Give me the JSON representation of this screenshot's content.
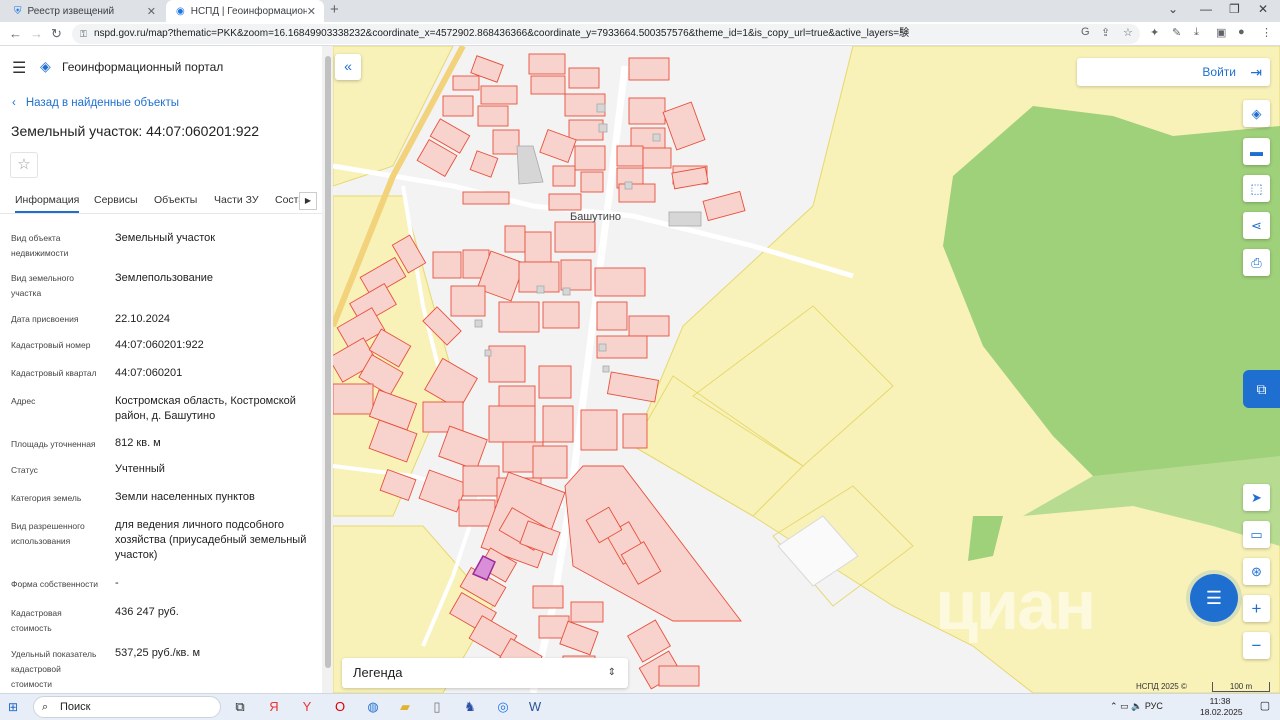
{
  "browser": {
    "tabs": [
      {
        "title": "Реестр извещений",
        "icon": "shield-icon"
      },
      {
        "title": "НСПД | Геоинформационный п",
        "icon": "globe-icon"
      }
    ],
    "url": "nspd.gov.ru/map?thematic=PKK&zoom=16.16849903338232&coordinate_x=4572902.868436366&coordinate_y=7933664.500357576&theme_id=1&is_copy_url=true&active_layers=験"
  },
  "sidebar": {
    "portal_name": "Геоинформационный портал",
    "back_link": "Назад в найденные объекты",
    "title": "Земельный участок: 44:07:060201:922",
    "tabs": [
      "Информация",
      "Сервисы",
      "Объекты",
      "Части ЗУ",
      "Соста"
    ],
    "fields": [
      {
        "label": "Вид объекта недвижимости",
        "value": "Земельный участок"
      },
      {
        "label": "Вид земельного участка",
        "value": "Землепользование"
      },
      {
        "label": "Дата присвоения",
        "value": "22.10.2024"
      },
      {
        "label": "Кадастровый номер",
        "value": "44:07:060201:922"
      },
      {
        "label": "Кадастровый квартал",
        "value": "44:07:060201"
      },
      {
        "label": "Адрес",
        "value": "Костромская область, Костромской район, д. Башутино"
      },
      {
        "label": "Площадь уточненная",
        "value": "812 кв. м"
      },
      {
        "label": "Статус",
        "value": "Учтенный"
      },
      {
        "label": "Категория земель",
        "value": "Земли населенных пунктов"
      },
      {
        "label": "Вид разрешенного использования",
        "value": "для ведения личного подсобного хозяйства (приусадебный земельный участок)"
      },
      {
        "label": "Форма собственности",
        "value": "-"
      },
      {
        "label": "Кадастровая стоимость",
        "value": "436 247 руб."
      },
      {
        "label": "Удельный показатель кадастровой стоимости",
        "value": "537,25 руб./кв. м"
      }
    ]
  },
  "map": {
    "login_label": "Войти",
    "village_label": "Башутино",
    "legend_label": "Легенда",
    "copyright": "НСПД 2025 ©",
    "scale_label": "100 m",
    "watermark": "циан",
    "colors": {
      "parcel_fill": "#f8d3cd",
      "parcel_stroke": "#e8503c",
      "selected": "#d98fd8",
      "field": "#f8f2b8",
      "forest": "#9fd07a",
      "road": "#ffffff",
      "accent": "#1f6fd1"
    },
    "tools": [
      "layers-icon",
      "ruler-icon",
      "select-area-icon",
      "share-icon",
      "print-icon",
      "locate-icon",
      "minimap-icon",
      "geo-search-icon",
      "zoom-in-icon",
      "zoom-out-icon"
    ]
  },
  "taskbar": {
    "search_label": "Поиск",
    "lang": "РУС",
    "time": "11:38",
    "date": "18.02.2025"
  }
}
